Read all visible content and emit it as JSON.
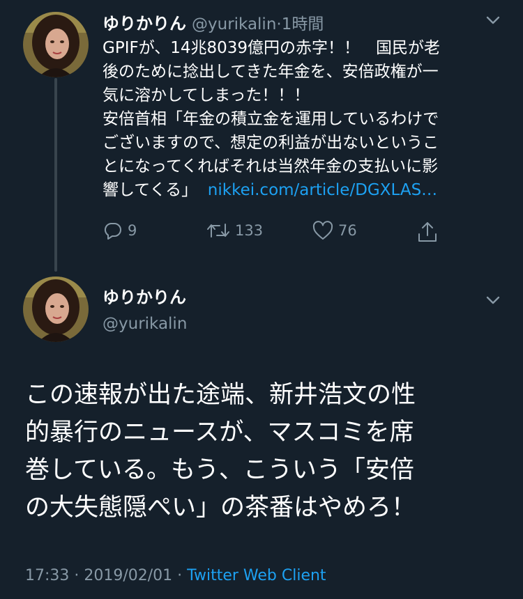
{
  "tweet1": {
    "name": "ゆりかりん",
    "handle": "@yurikalin",
    "separator": "·",
    "time": "1時間",
    "body_lines": [
      "GPIFが、14兆8039億円の赤字！！　国民が老",
      "後のために捻出してきた年金を、安倍政権が一",
      "気に溶かしてしまった！！！",
      "安倍首相「年金の積立金を運用しているわけで",
      "ございますので、想定の利益が出ないというこ",
      "とになってくればそれは当然年金の支払いに影"
    ],
    "last_line_text": "響してくる」",
    "link": "nikkei.com/article/DGXLAS…",
    "reply_count": "9",
    "retweet_count": "133",
    "like_count": "76"
  },
  "tweet2": {
    "name": "ゆりかりん",
    "handle": "@yurikalin",
    "body_lines": [
      "この速報が出た途端、新井浩文の性",
      "的暴行のニュースが、マスコミを席",
      "巻している。もう、こういう「安倍",
      "の大失態隠ぺい」の茶番はやめろ！"
    ],
    "timestamp": "17:33 · 2019/02/01",
    "separator": " · ",
    "client": "Twitter Web Client"
  },
  "colors": {
    "background": "#15202b",
    "text_primary": "#ffffff",
    "text_secondary": "#8899a6",
    "link": "#1da1f2",
    "thread_line": "#38444d"
  },
  "icons": [
    "chevron-down-icon",
    "reply-icon",
    "retweet-icon",
    "like-icon",
    "share-icon"
  ]
}
